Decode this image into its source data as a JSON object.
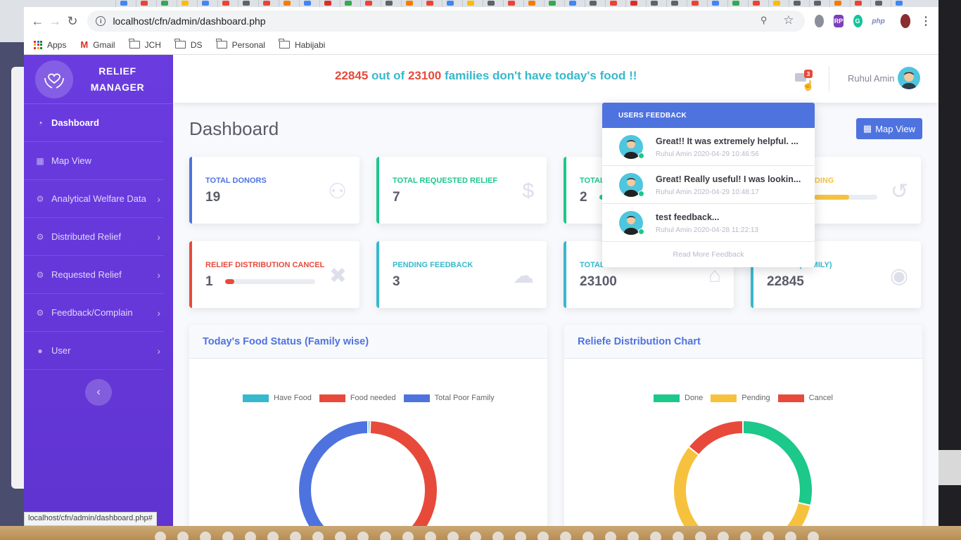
{
  "browser": {
    "url": "localhost/cfn/admin/dashboard.php",
    "bookmarks": [
      {
        "label": "Apps",
        "icon": "apps-grid-icon"
      },
      {
        "label": "Gmail",
        "icon": "gmail-icon"
      },
      {
        "label": "JCH",
        "icon": "folder-icon"
      },
      {
        "label": "DS",
        "icon": "folder-icon"
      },
      {
        "label": "Personal",
        "icon": "folder-icon"
      },
      {
        "label": "Habijabi",
        "icon": "folder-icon"
      }
    ],
    "ext_php": "php",
    "ext_rp": "RP",
    "ext_g": "G",
    "status_url": "localhost/cfn/admin/dashboard.php#"
  },
  "brand": {
    "line1": "RELIEF",
    "line2": "MANAGER"
  },
  "sidebar": {
    "items": [
      {
        "label": "Dashboard",
        "icon": "tachometer-icon",
        "active": true
      },
      {
        "label": "Map View",
        "icon": "map-icon"
      },
      {
        "label": "Analytical Welfare Data",
        "icon": "cog-icon",
        "chevron": true
      },
      {
        "label": "Distributed Relief",
        "icon": "cog-icon",
        "chevron": true
      },
      {
        "label": "Requested Relief",
        "icon": "cog-icon",
        "chevron": true
      },
      {
        "label": "Feedback/Complain",
        "icon": "cog-icon",
        "chevron": true
      },
      {
        "label": "User",
        "icon": "user-icon",
        "chevron": true
      }
    ]
  },
  "topbar": {
    "alert_count": "22845",
    "alert_mid": "out of",
    "alert_total": "23100",
    "alert_tail": "families don't have today's food !!",
    "mail_badge": "3",
    "username": "Ruhul Amin"
  },
  "page": {
    "title": "Dashboard",
    "map_view_button": "Map View"
  },
  "cards": [
    {
      "label": "TOTAL DONORS",
      "value": "19",
      "color": "#4e73df",
      "icon": "users-icon"
    },
    {
      "label": "TOTAL REQUESTED RELIEF",
      "value": "7",
      "color": "#1cc88a",
      "icon": "dollar-icon"
    },
    {
      "label": "TOTAL",
      "value": "2",
      "color": "#1cc88a",
      "icon": "check-icon"
    },
    {
      "label": "BUTION PENDING",
      "value": "",
      "color": "#f6c23e",
      "icon": "undo-icon",
      "progress": 0.55
    },
    {
      "label": "RELIEF DISTRIBUTION CANCEL",
      "value": "1",
      "color": "#e74a3b",
      "icon": "times-circle-icon",
      "progress": 0.1
    },
    {
      "label": "PENDING FEEDBACK",
      "value": "3",
      "color": "#36b9cc",
      "icon": "comments-icon"
    },
    {
      "label": "TOTAL",
      "value": "23100",
      "color": "#36b9cc",
      "icon": "home-icon"
    },
    {
      "label": "NEEDED(FAMILY)",
      "value": "22845",
      "color": "#36b9cc",
      "icon": "cookie-icon"
    }
  ],
  "feedback": {
    "header": "USERS FEEDBACK",
    "items": [
      {
        "text": "Great!! It was extremely helpful. ...",
        "meta": "Ruhul Amin 2020-04-29 10:46:56"
      },
      {
        "text": "Great! Really useful! I was lookin...",
        "meta": "Ruhul Amin 2020-04-29 10:48:17"
      },
      {
        "text": "test feedback...",
        "meta": "Ruhul Amin 2020-04-28 11:22:13"
      }
    ],
    "more": "Read More Feedback"
  },
  "panels": {
    "food_title": "Today's Food Status (Family wise)",
    "dist_title": "Reliefe Distribution Chart"
  },
  "chart_data": [
    {
      "type": "pie",
      "title": "Today's Food Status (Family wise)",
      "legend": [
        "Have Food",
        "Food needed",
        "Total Poor Family"
      ],
      "colors": [
        "#36b9cc",
        "#e74a3b",
        "#4e73df"
      ],
      "values": [
        255,
        22845,
        23100
      ]
    },
    {
      "type": "pie",
      "title": "Reliefe Distribution Chart",
      "legend": [
        "Done",
        "Pending",
        "Cancel"
      ],
      "colors": [
        "#1cc88a",
        "#f6c23e",
        "#e74a3b"
      ],
      "values": [
        2,
        4,
        1
      ]
    }
  ]
}
